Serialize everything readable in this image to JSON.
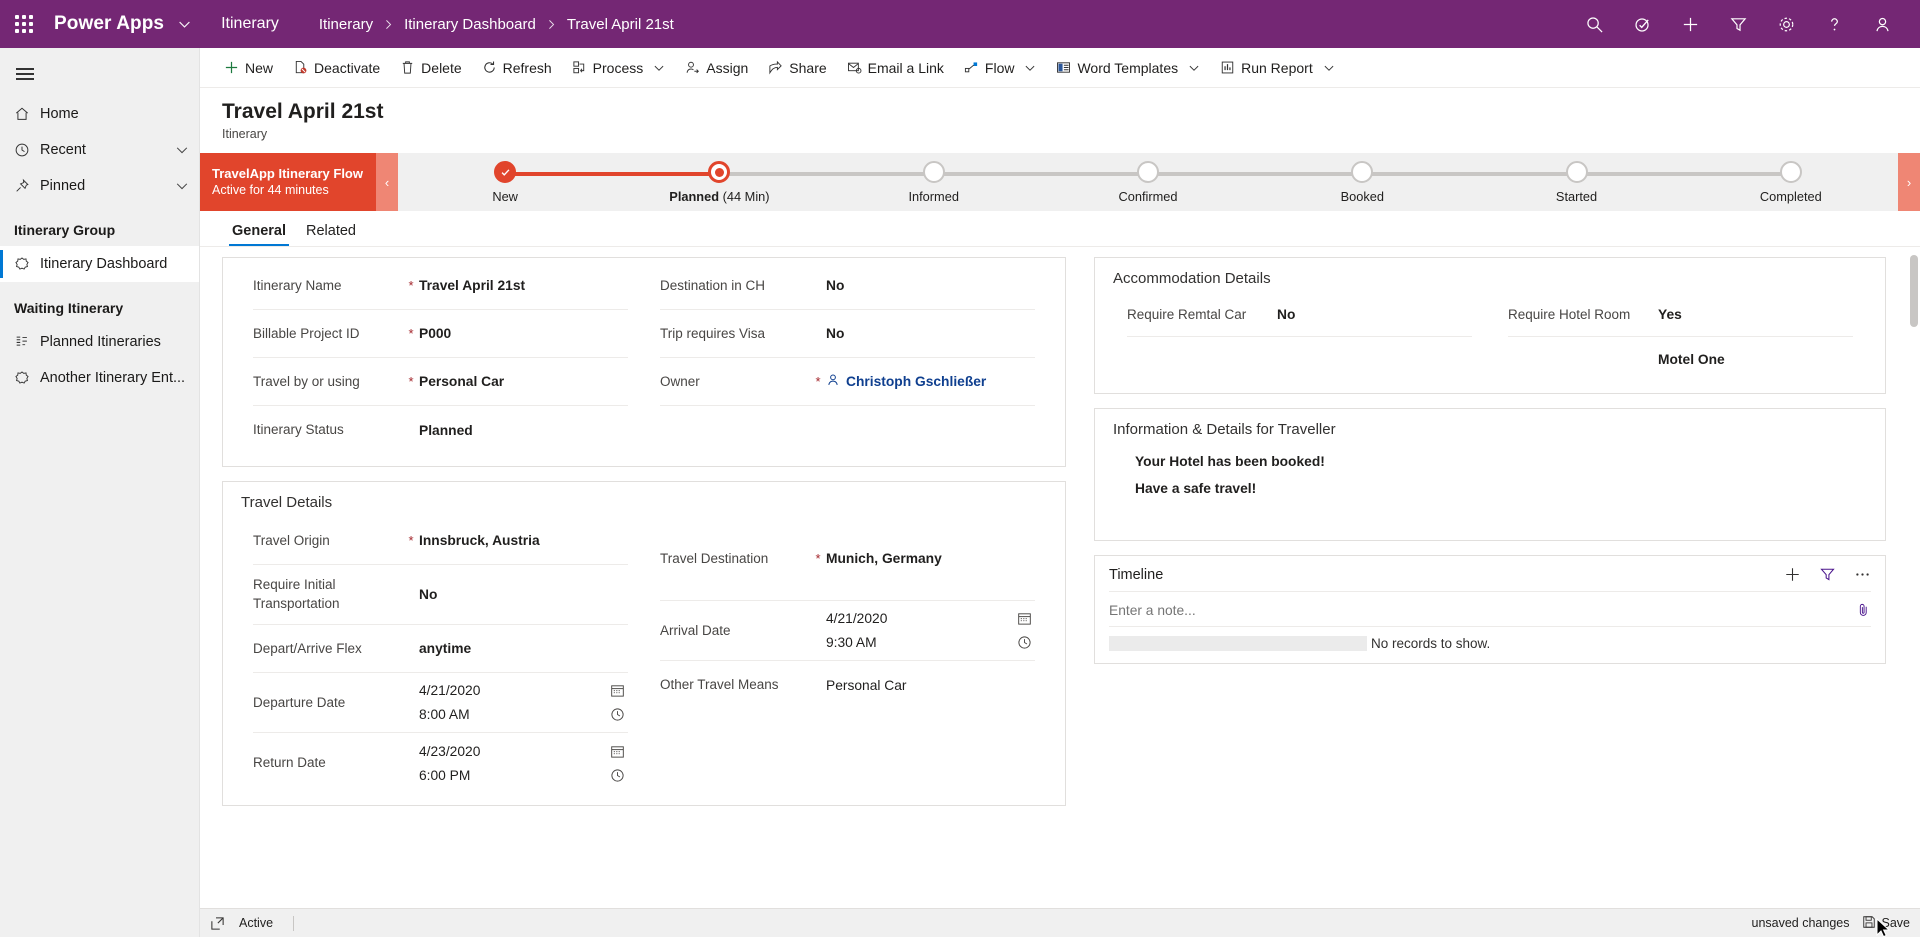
{
  "topbar": {
    "waffle_name": "app-launcher-icon",
    "brand": "Power Apps",
    "app_name": "Itinerary",
    "breadcrumbs": [
      "Itinerary",
      "Itinerary Dashboard",
      "Travel April 21st"
    ],
    "icons": [
      "search-icon",
      "assistant-check-icon",
      "add-icon",
      "filter-icon",
      "settings-gear-icon",
      "help-icon",
      "user-account-icon"
    ],
    "accent_color": "#742774"
  },
  "sidebar": {
    "menu_label": "Site Map",
    "items": [
      {
        "label": "Home",
        "icon": "home-icon",
        "chevron": false
      },
      {
        "label": "Recent",
        "icon": "clock-icon",
        "chevron": true
      },
      {
        "label": "Pinned",
        "icon": "pin-icon",
        "chevron": true
      }
    ],
    "groups": [
      {
        "title": "Itinerary Group",
        "items": [
          {
            "label": "Itinerary Dashboard",
            "icon": "dashboard-icon",
            "selected": true
          }
        ]
      },
      {
        "title": "Waiting Itinerary",
        "items": [
          {
            "label": "Planned Itineraries",
            "icon": "list-icon",
            "selected": false
          },
          {
            "label": "Another Itinerary Ent...",
            "icon": "dashboard-icon",
            "selected": false
          }
        ]
      }
    ]
  },
  "commandbar": {
    "items": [
      {
        "label": "New",
        "icon": "plus-icon",
        "chevron": false
      },
      {
        "label": "Deactivate",
        "icon": "deactivate-icon",
        "chevron": false
      },
      {
        "label": "Delete",
        "icon": "trash-icon",
        "chevron": false
      },
      {
        "label": "Refresh",
        "icon": "refresh-icon",
        "chevron": false
      },
      {
        "label": "Process",
        "icon": "process-icon",
        "chevron": true
      },
      {
        "label": "Assign",
        "icon": "assign-person-icon",
        "chevron": false
      },
      {
        "label": "Share",
        "icon": "share-icon",
        "chevron": false
      },
      {
        "label": "Email a Link",
        "icon": "email-link-icon",
        "chevron": false
      },
      {
        "label": "Flow",
        "icon": "flow-icon",
        "chevron": true
      },
      {
        "label": "Word Templates",
        "icon": "word-template-icon",
        "chevron": true
      },
      {
        "label": "Run Report",
        "icon": "report-icon",
        "chevron": true
      }
    ]
  },
  "record": {
    "title": "Travel April 21st",
    "subtitle": "Itinerary"
  },
  "process_flow": {
    "name": "TravelApp Itinerary Flow",
    "status": "Active for 44 minutes",
    "prev_label": "‹",
    "next_label": "›",
    "accent_color": "#e1452c",
    "stages": [
      {
        "label": "New",
        "duration": "",
        "state": "done"
      },
      {
        "label": "Planned",
        "duration": "(44 Min)",
        "state": "active"
      },
      {
        "label": "Informed",
        "duration": "",
        "state": "pending"
      },
      {
        "label": "Confirmed",
        "duration": "",
        "state": "pending"
      },
      {
        "label": "Booked",
        "duration": "",
        "state": "pending"
      },
      {
        "label": "Started",
        "duration": "",
        "state": "pending"
      },
      {
        "label": "Completed",
        "duration": "",
        "state": "pending"
      }
    ]
  },
  "tabs": [
    {
      "label": "General",
      "active": true
    },
    {
      "label": "Related",
      "active": false
    }
  ],
  "summary": {
    "left_fields": [
      {
        "label": "Itinerary Name",
        "required": true,
        "value": "Travel April 21st"
      },
      {
        "label": "Billable Project ID",
        "required": true,
        "value": "P000"
      },
      {
        "label": "Travel by or using",
        "required": true,
        "value": "Personal Car"
      },
      {
        "label": "Itinerary Status",
        "required": false,
        "value": "Planned"
      }
    ],
    "right_fields": [
      {
        "label": "Destination in CH",
        "required": false,
        "value": "No"
      },
      {
        "label": "Trip requires Visa",
        "required": false,
        "value": "No"
      },
      {
        "label": "Owner",
        "required": true,
        "value": "Christoph Gschließer",
        "is_link": true,
        "icon": "person-icon"
      }
    ]
  },
  "travel_details": {
    "title": "Travel Details",
    "left_fields": [
      {
        "label": "Travel Origin",
        "required": true,
        "value": "Innsbruck, Austria",
        "type": "text"
      },
      {
        "label": "Require Initial Transportation",
        "required": false,
        "value": "No",
        "type": "text"
      },
      {
        "label": "Depart/Arrive Flex",
        "required": false,
        "value": "anytime",
        "type": "text"
      },
      {
        "label": "Departure Date",
        "required": false,
        "type": "datetime",
        "date": "4/21/2020",
        "time": "8:00 AM",
        "date_icon": "calendar-icon",
        "time_icon": "clock-icon"
      },
      {
        "label": "Return Date",
        "required": false,
        "type": "datetime",
        "date": "4/23/2020",
        "time": "6:00 PM",
        "date_icon": "calendar-icon",
        "time_icon": "clock-icon"
      }
    ],
    "right_fields": [
      {
        "label": "Travel Destination",
        "required": true,
        "value": "Munich, Germany",
        "type": "text"
      },
      {
        "label": "Arrival Date",
        "required": false,
        "type": "datetime",
        "date": "4/21/2020",
        "time": "9:30 AM",
        "date_icon": "calendar-icon",
        "time_icon": "clock-icon"
      },
      {
        "label": "Other Travel Means",
        "required": false,
        "value": "Personal Car",
        "type": "text_normal"
      }
    ]
  },
  "accommodation": {
    "title": "Accommodation Details",
    "left_fields": [
      {
        "label": "Require Remtal Car",
        "value": "No"
      }
    ],
    "right_fields": [
      {
        "label": "Require Hotel Room",
        "value": "Yes"
      },
      {
        "label": "",
        "value": "Motel One"
      }
    ]
  },
  "information": {
    "title": "Information & Details for Traveller",
    "lines": [
      "Your Hotel has been booked!",
      "Have a safe travel!"
    ]
  },
  "timeline": {
    "title": "Timeline",
    "actions": [
      {
        "name": "add-timeline-icon",
        "label": "+"
      },
      {
        "name": "filter-timeline-icon",
        "label": "filter"
      },
      {
        "name": "more-options-icon",
        "label": "…"
      }
    ],
    "note_placeholder": "Enter a note...",
    "attach_icon": "paperclip-icon",
    "empty_message": "No records to show."
  },
  "statusbar": {
    "popout_icon": "open-in-new-icon",
    "state": "Active",
    "unsaved_text": "unsaved changes",
    "save_label": "Save",
    "save_icon": "save-icon"
  }
}
